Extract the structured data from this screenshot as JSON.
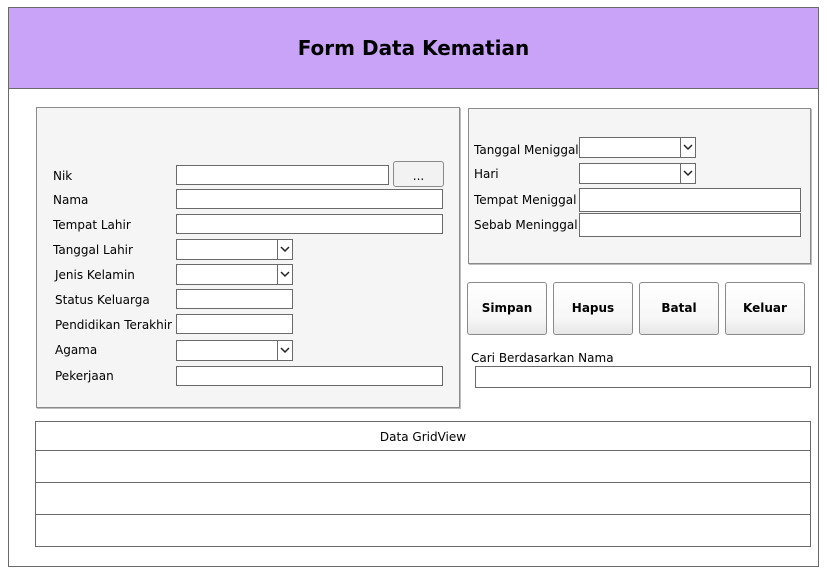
{
  "window": {
    "title": "Form Data Kematian"
  },
  "left_panel": {
    "fields": [
      {
        "label": "Nik"
      },
      {
        "label": "Nama"
      },
      {
        "label": "Tempat Lahir"
      },
      {
        "label": "Tanggal Lahir"
      },
      {
        "label": "Jenis Kelamin"
      },
      {
        "label": "Status Keluarga"
      },
      {
        "label": "Pendidikan Terakhir"
      },
      {
        "label": "Agama"
      },
      {
        "label": "Pekerjaan"
      }
    ],
    "browse_label": "..."
  },
  "right_panel": {
    "fields": [
      {
        "label": "Tanggal Meniggal"
      },
      {
        "label": "Hari"
      },
      {
        "label": "Tempat Meniggal"
      },
      {
        "label": "Sebab Meninggal"
      }
    ]
  },
  "buttons": {
    "simpan": "Simpan",
    "hapus": "Hapus",
    "batal": "Batal",
    "keluar": "Keluar"
  },
  "search": {
    "label": "Cari Berdasarkan Nama",
    "value": ""
  },
  "grid": {
    "title": "Data GridView",
    "rows": 3
  },
  "icons": {
    "combo_arrow": "chevron-down-icon"
  }
}
